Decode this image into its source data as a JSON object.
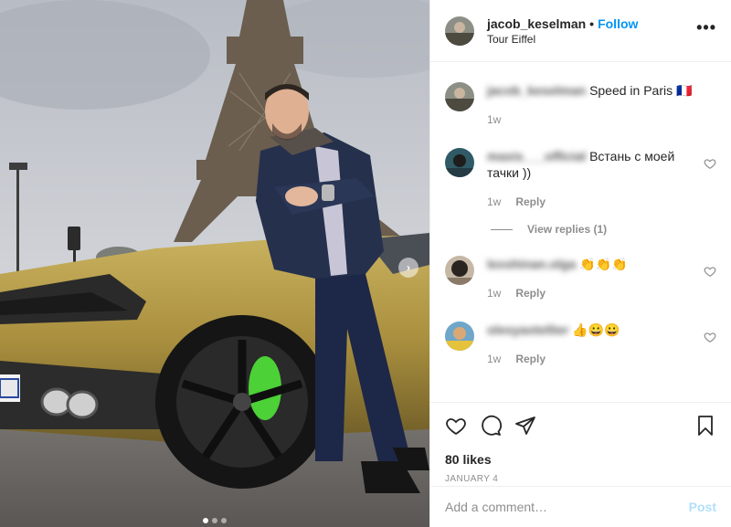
{
  "post": {
    "username": "jacob_keselman",
    "separator": "•",
    "follow_label": "Follow",
    "location": "Tour Eiffel",
    "more_label": "•••",
    "photo_next_arrow": "›",
    "carousel_dots": 3,
    "carousel_active": 1
  },
  "comments": [
    {
      "author": "jacob_keselman",
      "text": "Speed in Paris 🇫🇷",
      "time": "1w",
      "reply_label": "",
      "author_blurred": true
    },
    {
      "author": "maxis___official",
      "text": "Встань с моей тачки ))",
      "time": "1w",
      "reply_label": "Reply",
      "author_blurred": true
    },
    {
      "author": "lexshinan.olga",
      "text": "👏👏👏",
      "time": "1w",
      "reply_label": "Reply",
      "author_blurred": true
    },
    {
      "author": "olesyaotellier",
      "text": "👍😀😀",
      "time": "1w",
      "reply_label": "Reply",
      "author_blurred": true
    }
  ],
  "view_replies_label": "View replies (1)",
  "actions": {
    "like_icon": "heart-icon",
    "comment_icon": "comment-icon",
    "share_icon": "share-icon",
    "save_icon": "bookmark-icon"
  },
  "likes_label": "80 likes",
  "date_label": "JANUARY 4",
  "add_comment": {
    "placeholder": "Add a comment…",
    "post_label": "Post"
  },
  "colors": {
    "accent": "#0095f6",
    "post_disabled": "#b2dffc",
    "secondary_text": "#8e8e8e",
    "car_gold": "#b39a45",
    "caliper_green": "#4cd137"
  }
}
